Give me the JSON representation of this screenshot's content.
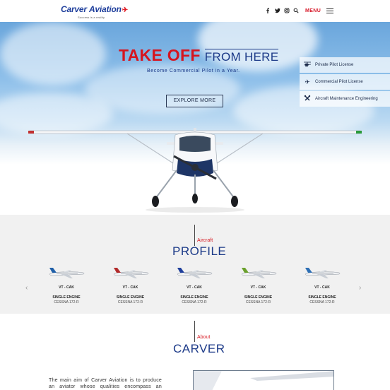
{
  "header": {
    "logo_carver": "Carver",
    "logo_aviation": "Aviation",
    "logo_tagline": "Success is a reality",
    "social_icons": [
      "facebook-icon",
      "twitter-icon",
      "instagram-icon",
      "search-icon"
    ],
    "menu_label": "MENU"
  },
  "hero": {
    "title_red": "TAKE OFF",
    "title_blue": "FROM HERE",
    "subtitle": "Become Commercial Pilot in a Year.",
    "cta_label": "EXPLORE MORE",
    "courses": [
      {
        "icon": "helicopter-icon",
        "label": "Private Pilot License"
      },
      {
        "icon": "airplane-icon",
        "label": "Commercial Pilot License"
      },
      {
        "icon": "wrench-icon",
        "label": "Aircraft Maintenance Engineering"
      }
    ]
  },
  "profile": {
    "small_title": "Aircraft",
    "big_title": "PROFILE",
    "prev_icon": "chevron-left-icon",
    "next_icon": "chevron-right-icon",
    "aircraft": [
      {
        "reg": "VT - CAK",
        "engine": "SINGLE ENGINE",
        "model": "CESSNA 172-R",
        "tail_color": "#1f5fa8"
      },
      {
        "reg": "VT - CAK",
        "engine": "SINGLE ENGINE",
        "model": "CESSNA 172-R",
        "tail_color": "#b22a2a"
      },
      {
        "reg": "VT - CAK",
        "engine": "SINGLE ENGINE",
        "model": "CESSNA 172-R",
        "tail_color": "#1f3f9c"
      },
      {
        "reg": "VT - CAK",
        "engine": "SINGLE ENGINE",
        "model": "CESSNA 172-R",
        "tail_color": "#6aa02c"
      },
      {
        "reg": "VT - CAK",
        "engine": "SINGLE ENGINE",
        "model": "CESSNA 172-R",
        "tail_color": "#2d6fb5"
      }
    ]
  },
  "about": {
    "small_title": "About",
    "big_title": "CARVER",
    "text": "The main aim of Carver Aviation is to produce an aviator whose qualities encompass an optimum"
  },
  "colors": {
    "brand_blue": "#1c3a88",
    "brand_red": "#d6151f"
  }
}
